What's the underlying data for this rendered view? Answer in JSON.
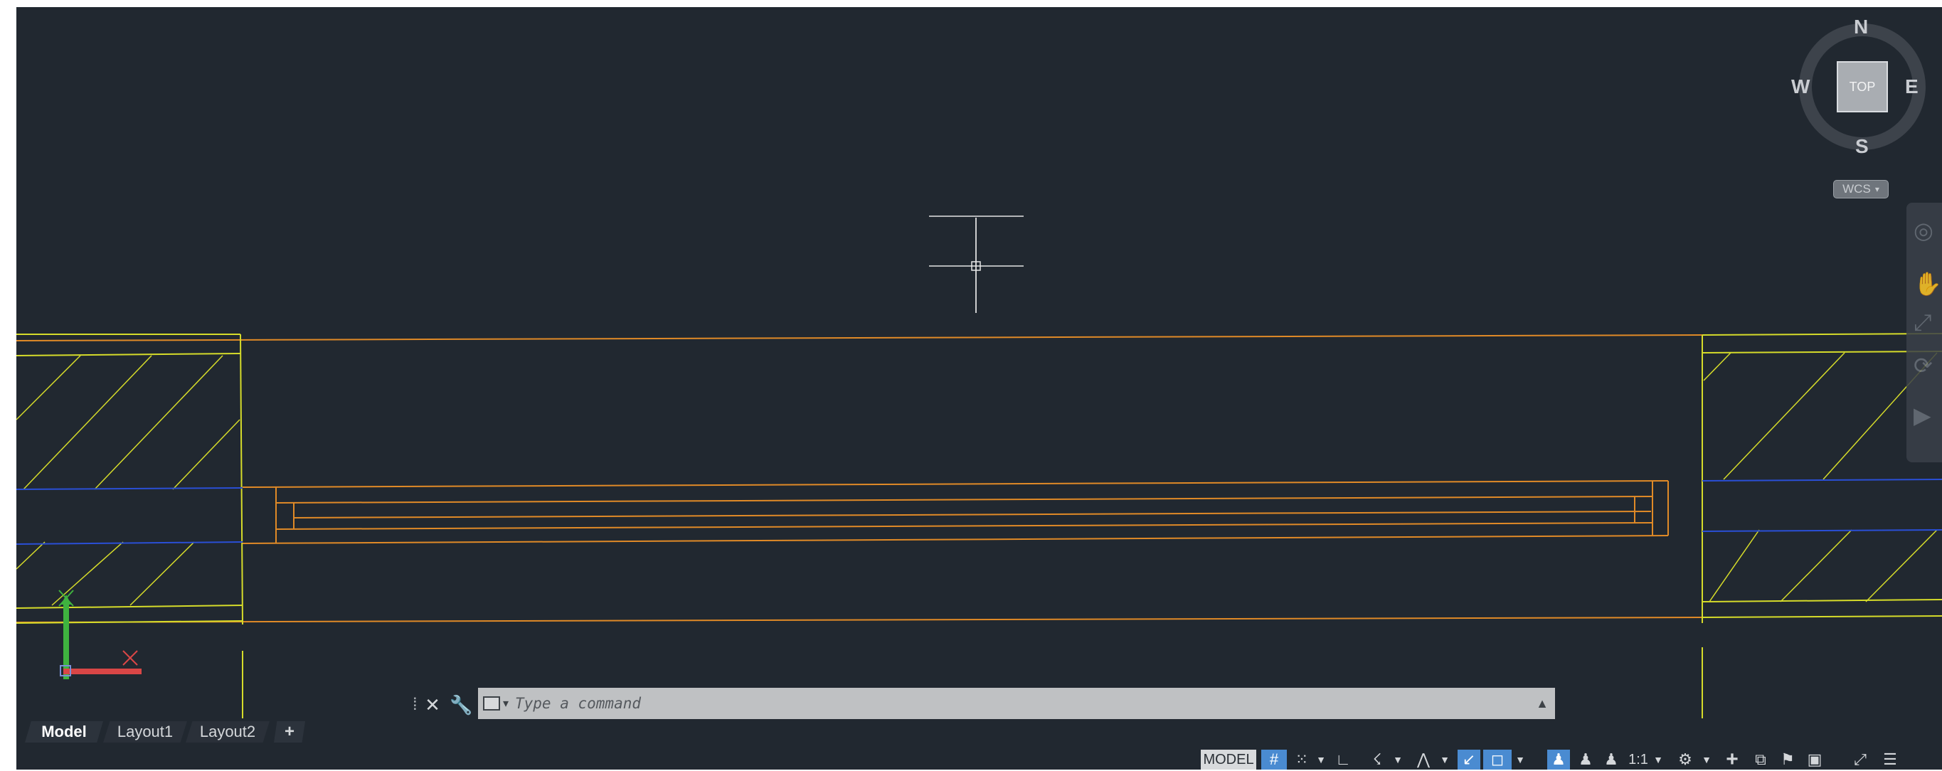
{
  "viewcube": {
    "north": "N",
    "south": "S",
    "west": "W",
    "east": "E",
    "face": "TOP",
    "wcs_label": "WCS",
    "wcs_arrow": "▾"
  },
  "command_line": {
    "placeholder": "Type a command",
    "close_glyph": "✕",
    "settings_glyph": "🔧",
    "history_glyph": "▲",
    "grip_glyph": "⁞"
  },
  "tabs": {
    "items": [
      {
        "label": "Model"
      },
      {
        "label": "Layout1"
      },
      {
        "label": "Layout2"
      }
    ],
    "add_label": "+"
  },
  "status_bar": {
    "model_label": "MODEL",
    "scale_label": "1:1",
    "icons": [
      "grid-icon",
      "snap-icon",
      "ortho-icon",
      "polar-icon",
      "isodraft-icon",
      "osnap-icon",
      "otrack-icon",
      "annotation-visibility-icon",
      "annotation-autoscale-icon",
      "annotation-scale-icon",
      "workspace-gear-icon",
      "plus-icon",
      "isolate-icon",
      "hardware-accel-icon",
      "clean-screen-icon",
      "customize-icon"
    ]
  },
  "colors": {
    "canvas_bg": "#212830",
    "orange_line": "#e08a27",
    "yellow_line": "#d6dc2a",
    "blue_line": "#2a4fd6",
    "active_blue": "#4a8bd1"
  }
}
